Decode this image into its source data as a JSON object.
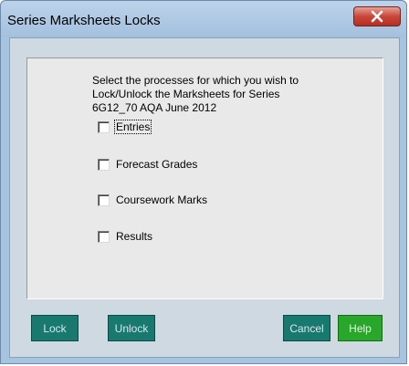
{
  "window": {
    "title": "Series Marksheets Locks"
  },
  "dialog": {
    "instruction": "Select the processes for which you wish to\nLock/Unlock the Marksheets for Series\n6G12_70 AQA June 2012",
    "options": [
      {
        "label": "Entries",
        "checked": false
      },
      {
        "label": "Forecast Grades",
        "checked": false
      },
      {
        "label": "Coursework Marks",
        "checked": false
      },
      {
        "label": "Results",
        "checked": false
      }
    ]
  },
  "buttons": {
    "lock": "Lock",
    "unlock": "Unlock",
    "cancel": "Cancel",
    "help": "Help"
  },
  "icons": {
    "close": "close-icon"
  },
  "colors": {
    "button_teal": "#18796f",
    "button_green": "#29a72b",
    "close_red": "#c9473a",
    "title_bar": "#a6c3e0"
  }
}
